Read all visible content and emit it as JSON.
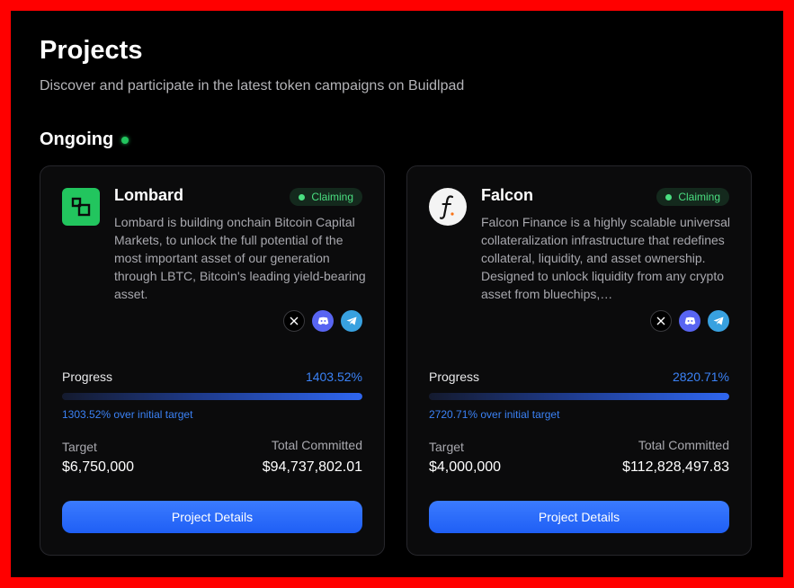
{
  "page": {
    "title": "Projects",
    "subtitle": "Discover and participate in the latest token campaigns on Buidlpad"
  },
  "section": {
    "title": "Ongoing",
    "live_color": "#22c55e"
  },
  "labels": {
    "progress": "Progress",
    "target": "Target",
    "total_committed": "Total Committed",
    "details_button": "Project Details"
  },
  "projects": [
    {
      "name": "Lombard",
      "logo_icon": "lombard-logo-icon",
      "status": "Claiming",
      "description": "Lombard is building onchain Bitcoin Capital Markets, to unlock the full potential of the most important asset of our generation through LBTC, Bitcoin's leading yield-bearing asset.",
      "socials": [
        "x-icon",
        "discord-icon",
        "telegram-icon"
      ],
      "progress": "1403.52%",
      "over_target": "1303.52% over initial target",
      "progress_fill_fraction": 1.0,
      "target": "$6,750,000",
      "total_committed": "$94,737,802.01"
    },
    {
      "name": "Falcon",
      "logo_icon": "falcon-logo-icon",
      "status": "Claiming",
      "description": "Falcon Finance is a highly scalable universal collateralization infrastructure that redefines collateral, liquidity, and asset ownership. Designed to unlock liquidity from any crypto asset from bluechips,…",
      "socials": [
        "x-icon",
        "discord-icon",
        "telegram-icon"
      ],
      "progress": "2820.71%",
      "over_target": "2720.71% over initial target",
      "progress_fill_fraction": 1.0,
      "target": "$4,000,000",
      "total_committed": "$112,828,497.83"
    }
  ],
  "colors": {
    "accent": "#3b82f6",
    "status_green": "#4ade80",
    "lombard_brand": "#22c55e",
    "discord": "#5865f2",
    "telegram": "#38a1e0"
  }
}
